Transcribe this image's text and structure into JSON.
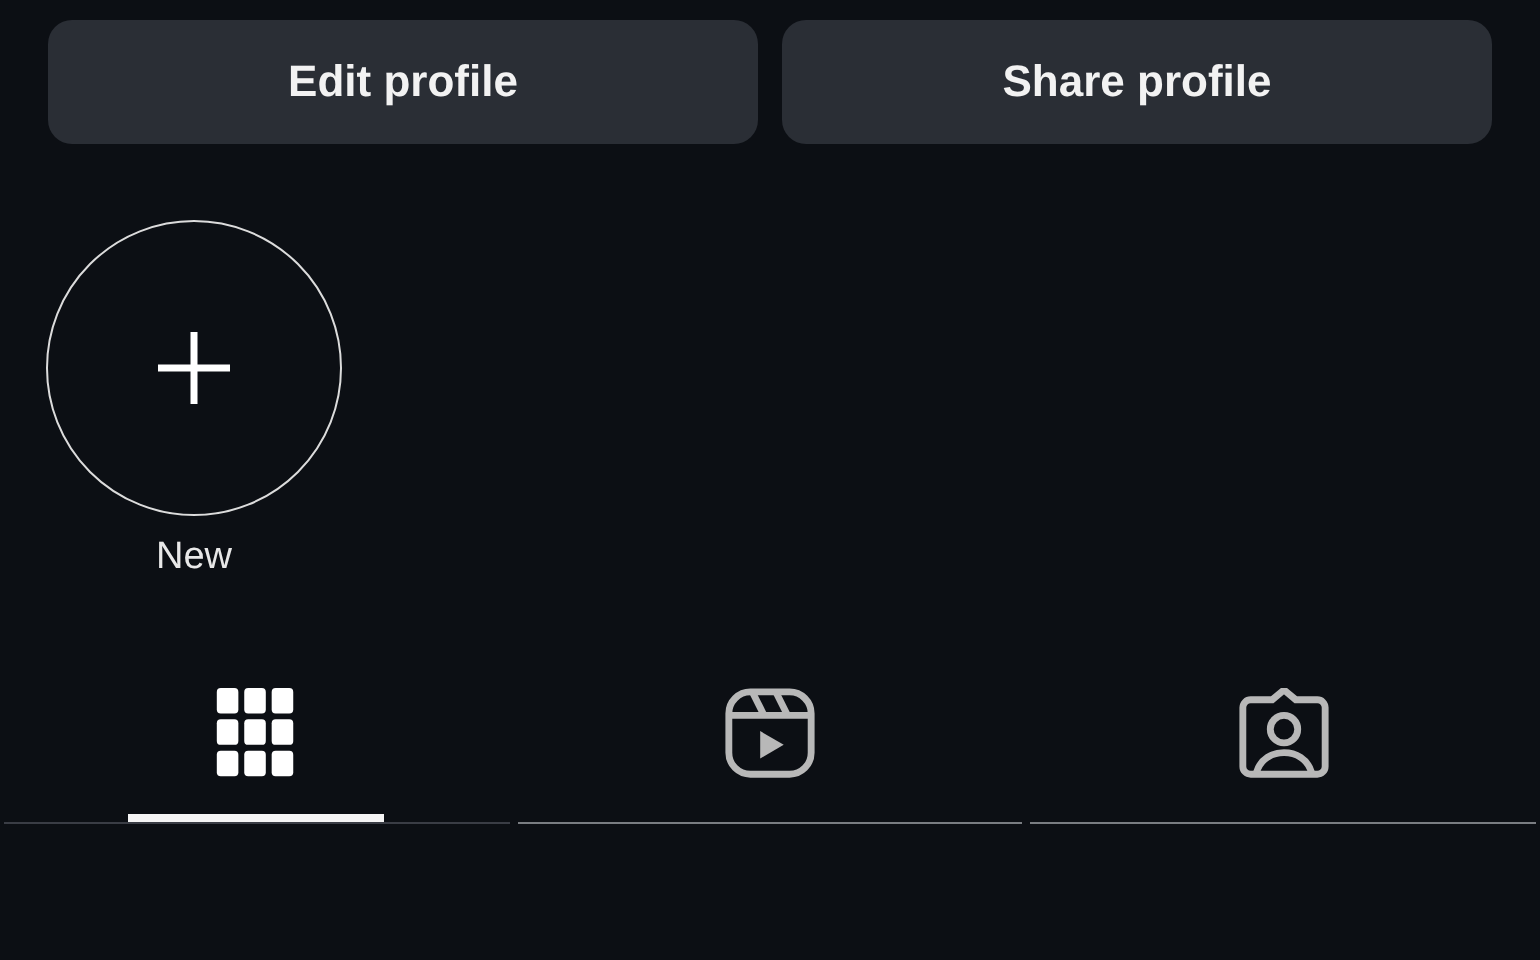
{
  "actions": [
    "Edit profile",
    "Share profile"
  ],
  "highlights": [
    {
      "label": "New"
    }
  ],
  "tabs": [
    {
      "kind": "grid",
      "selected": true
    },
    {
      "kind": "reels",
      "selected": false
    },
    {
      "kind": "tagged",
      "selected": false
    }
  ]
}
